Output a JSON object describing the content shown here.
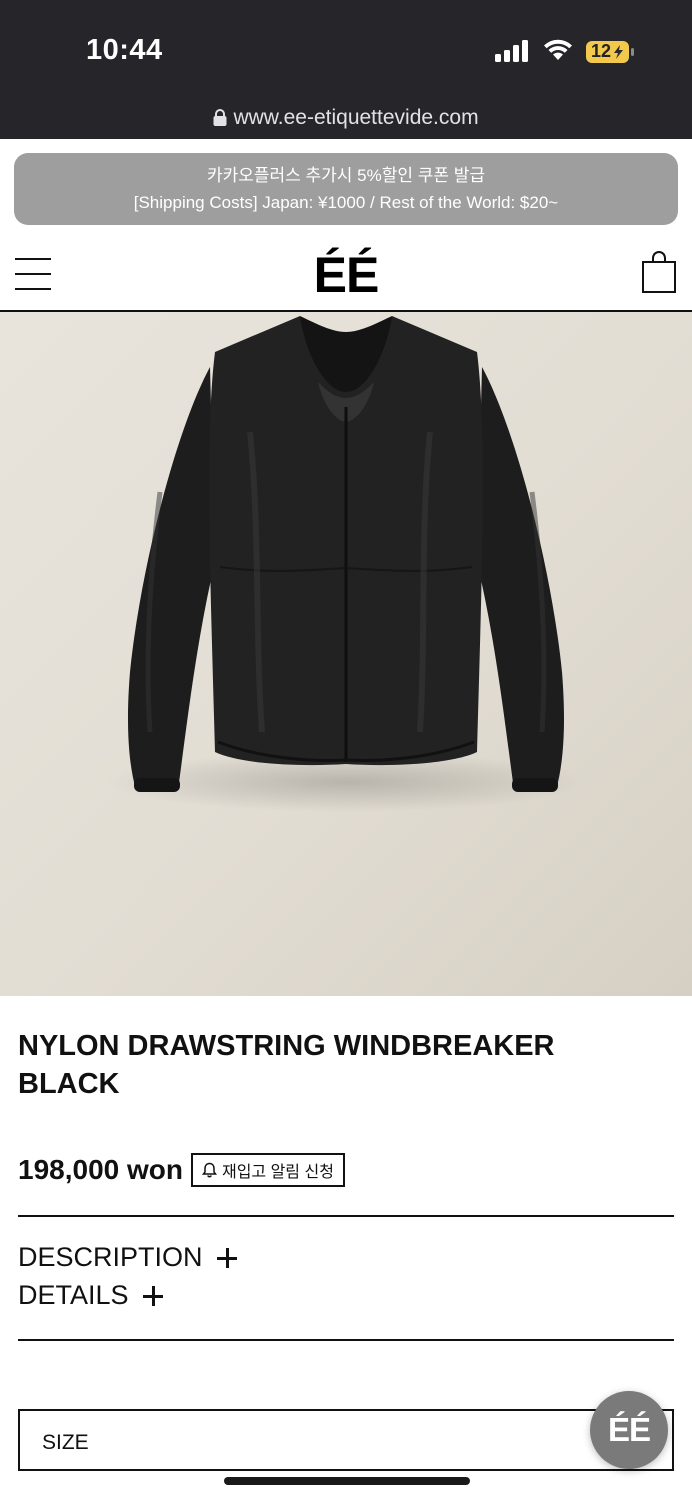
{
  "status_bar": {
    "time": "10:44",
    "battery_level": "12",
    "battery_color": "#f2c94c"
  },
  "browser": {
    "url": "www.ee-etiquettevide.com"
  },
  "banner": {
    "line1": "카카오플러스 추가시 5%할인 쿠폰 발급",
    "line2": "[Shipping Costs] Japan: ¥1000 / Rest of the World: $20~"
  },
  "header": {
    "logo": "ÉÉ"
  },
  "product": {
    "title_line1": "NYLON DRAWSTRING WINDBREAKER",
    "title_line2": "BLACK",
    "price": "198,000 won",
    "restock_label": "재입고 알림 신청",
    "image_icon": "jacket-image"
  },
  "accordion": {
    "description": "DESCRIPTION",
    "details": "DETAILS"
  },
  "options": {
    "size_label": "SIZE"
  },
  "fab": {
    "label": "ÉÉ"
  }
}
